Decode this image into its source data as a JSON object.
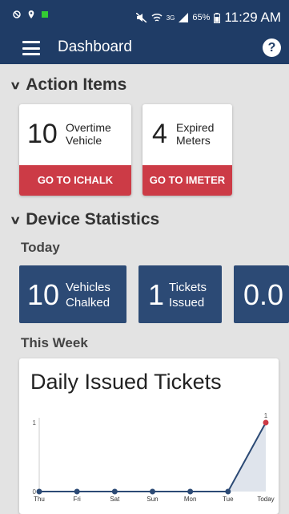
{
  "status_bar": {
    "icons": [
      "no-disturb-icon",
      "location-icon",
      "green-notification-icon",
      "mute-icon",
      "wifi-icon",
      "signal-icon",
      "battery-icon"
    ],
    "network": "3G",
    "battery": "65%",
    "time": "11:29 AM"
  },
  "app_bar": {
    "title": "Dashboard",
    "menu_icon": "hamburger-icon",
    "help_icon": "help-icon",
    "help_glyph": "?",
    "color": "#1f3c66"
  },
  "action_items": {
    "header": "Action Items",
    "cards": [
      {
        "count": "10",
        "label_line1": "Overtime",
        "label_line2": "Vehicle",
        "button": "GO TO ICHALK"
      },
      {
        "count": "4",
        "label_line1": "Expired",
        "label_line2": "Meters",
        "button": "GO TO IMETER"
      }
    ],
    "button_color": "#cc3b46"
  },
  "device_statistics": {
    "header": "Device Statistics",
    "today_label": "Today",
    "stats": [
      {
        "count": "10",
        "label_line1": "Vehicles",
        "label_line2": "Chalked"
      },
      {
        "count": "1",
        "label_line1": "Tickets",
        "label_line2": "Issued"
      },
      {
        "count": "0.0"
      }
    ],
    "tile_color": "#2c4a75",
    "week_label": "This Week"
  },
  "chart_data": {
    "type": "area",
    "title": "Daily Issued Tickets",
    "categories": [
      "Thu",
      "Fri",
      "Sat",
      "Sun",
      "Mon",
      "Tue",
      "Today"
    ],
    "values": [
      0,
      0,
      0,
      0,
      0,
      0,
      1
    ],
    "ylim": [
      0,
      1
    ],
    "y_ticks": [
      "0",
      "1"
    ],
    "data_labels": [
      "1"
    ],
    "line_color": "#2c4a75",
    "last_point_color": "#cc3b46",
    "grid": false
  }
}
